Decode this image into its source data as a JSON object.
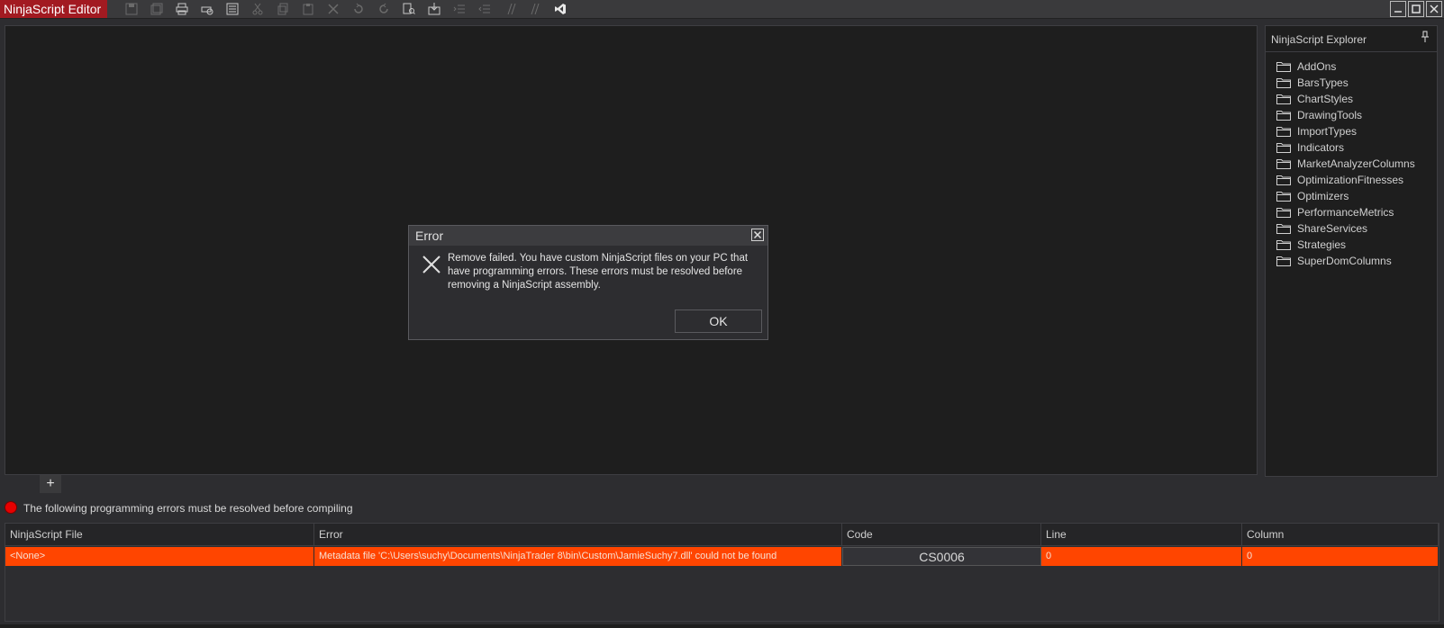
{
  "window": {
    "title": "NinjaScript Editor"
  },
  "toolbar": {
    "icons": [
      "save-icon",
      "save-all-icon",
      "print-icon",
      "print-preview-icon",
      "properties-icon",
      "cut-icon",
      "copy-icon",
      "paste-icon",
      "delete-icon",
      "undo-icon",
      "redo-icon",
      "find-icon",
      "compile-icon",
      "indent-icon",
      "outdent-icon",
      "comment-icon",
      "uncomment-icon",
      "visual-studio-icon"
    ]
  },
  "explorer": {
    "title": "NinjaScript Explorer",
    "folders": [
      "AddOns",
      "BarsTypes",
      "ChartStyles",
      "DrawingTools",
      "ImportTypes",
      "Indicators",
      "MarketAnalyzerColumns",
      "OptimizationFitnesses",
      "Optimizers",
      "PerformanceMetrics",
      "ShareServices",
      "Strategies",
      "SuperDomColumns"
    ]
  },
  "tabs": {
    "add_label": "+"
  },
  "errors": {
    "message": "The following programming errors must be resolved before compiling",
    "columns": [
      "NinjaScript File",
      "Error",
      "Code",
      "Line",
      "Column"
    ],
    "rows": [
      {
        "file": "<None>",
        "error": "Metadata file 'C:\\Users\\suchy\\Documents\\NinjaTrader 8\\bin\\Custom\\JamieSuchy7.dll' could not be found",
        "code": "CS0006",
        "line": "0",
        "column": "0"
      }
    ]
  },
  "dialog": {
    "title": "Error",
    "message": "Remove failed. You have custom NinjaScript files on your PC that have programming errors. These errors must be resolved before removing a NinjaScript assembly.",
    "ok_label": "OK"
  },
  "colors": {
    "title_accent": "#a21a21",
    "error_row": "#ff4500",
    "error_dot": "#e60000"
  }
}
